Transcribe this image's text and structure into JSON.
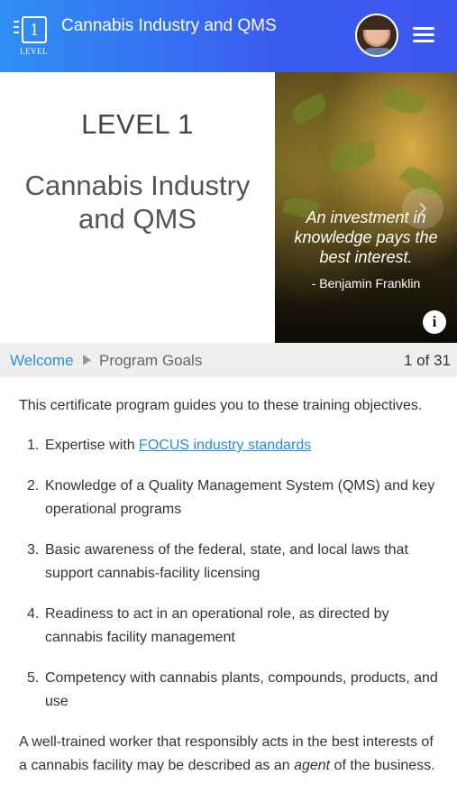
{
  "header": {
    "badge_number": "1",
    "badge_label": "LEVEL",
    "title": "Cannabis Industry and QMS"
  },
  "hero": {
    "level": "LEVEL 1",
    "title": "Cannabis Industry and QMS",
    "quote": "An investment in knowledge pays the best interest.",
    "quote_author": "- Benjamin Franklin",
    "next_arrow": "›",
    "info_glyph": "i"
  },
  "breadcrumb": {
    "home": "Welcome",
    "current": "Program Goals",
    "page_indicator": "1 of 31"
  },
  "content": {
    "intro": "This certificate program guides you to these training objectives.",
    "goals": [
      {
        "number": "1.",
        "prefix": "Expertise with ",
        "link": "FOCUS industry standards"
      },
      {
        "number": "2.",
        "text": "Knowledge of a Quality Management System (QMS) and key operational programs"
      },
      {
        "number": "3.",
        "text": "Basic awareness of the federal, state, and local laws that support cannabis-facility licensing"
      },
      {
        "number": "4.",
        "text": "Readiness to act in an operational role, as directed by cannabis facility management"
      },
      {
        "number": "5.",
        "text": "Competency with cannabis plants, compounds, products, and use"
      }
    ],
    "outro_before": "A well-trained worker that responsibly acts in the best interests of a cannabis facility may be described as an ",
    "outro_emphasis": "agent",
    "outro_after": " of the business."
  },
  "colors": {
    "header_start": "#2f8ff3",
    "header_end": "#3d56ef",
    "link": "#2a8be0",
    "breadcrumb_bg": "#efefef"
  },
  "icons": [
    "level-badge-icon",
    "avatar",
    "hamburger-menu-icon",
    "chevron-right-icon",
    "info-icon",
    "breadcrumb-arrow-icon"
  ]
}
